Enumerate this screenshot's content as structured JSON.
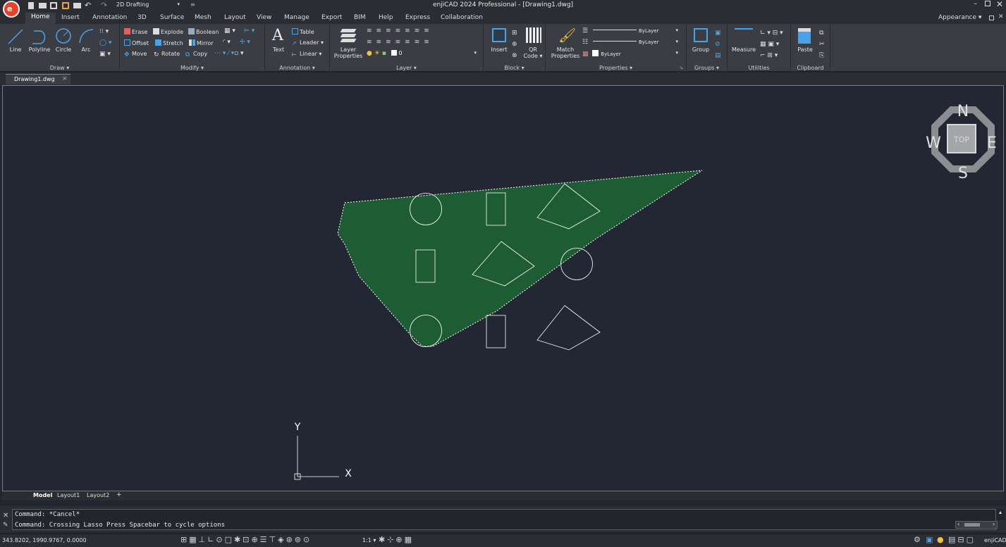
{
  "app": {
    "title": "enjiCAD 2024 Professional - [Drawing1.dwg]",
    "workspace": "2D Drafting",
    "accent_color": "#e8432a"
  },
  "ribbon_tabs": [
    "Home",
    "Insert",
    "Annotation",
    "3D",
    "Surface",
    "Mesh",
    "Layout",
    "View",
    "Manage",
    "Export",
    "BIM",
    "Help",
    "Express",
    "Collaboration"
  ],
  "appearance_label": "Appearance",
  "panels": {
    "draw": {
      "title": "Draw",
      "line": "Line",
      "polyline": "Polyline",
      "circle": "Circle",
      "arc": "Arc"
    },
    "modify": {
      "title": "Modify",
      "erase": "Erase",
      "explode": "Explode",
      "boolean": "Boolean",
      "offset": "Offset",
      "stretch": "Stretch",
      "mirror": "Mirror",
      "move": "Move",
      "rotate": "Rotate",
      "copy": "Copy"
    },
    "annotation": {
      "title": "Annotation",
      "text": "Text",
      "table": "Table",
      "leader": "Leader",
      "linear": "Linear"
    },
    "layer": {
      "title": "Layer",
      "layer_properties_1": "Layer",
      "layer_properties_2": "Properties",
      "current_layer": "0"
    },
    "block": {
      "title": "Block",
      "insert": "Insert",
      "qr_1": "QR",
      "qr_2": "Code"
    },
    "properties": {
      "title": "Properties",
      "match_1": "Match",
      "match_2": "Properties",
      "linetype": "ByLayer",
      "lineweight": "ByLayer",
      "color": "ByLayer"
    },
    "groups": {
      "title": "Groups",
      "group": "Group"
    },
    "utilities": {
      "title": "Utilities",
      "measure": "Measure"
    },
    "clipboard": {
      "title": "Clipboard",
      "paste": "Paste"
    }
  },
  "doc_tab": "Drawing1.dwg",
  "viewcube": {
    "n": "N",
    "s": "S",
    "e": "E",
    "w": "W",
    "face": "TOP"
  },
  "ucs": {
    "x": "X",
    "y": "Y"
  },
  "layout_tabs": [
    "Model",
    "Layout1",
    "Layout2",
    "+"
  ],
  "command_history": [
    "Command: *Cancel*",
    "Command: Crossing Lasso  Press Spacebar to cycle options"
  ],
  "status": {
    "coords": "343.8202, 1990.9767, 0.0000",
    "scale": "1:1",
    "brand": "enjiCAD"
  },
  "colors": {
    "lasso_fill": "#1e5c33",
    "canvas_bg": "#222733",
    "entity": "#ffffff"
  }
}
